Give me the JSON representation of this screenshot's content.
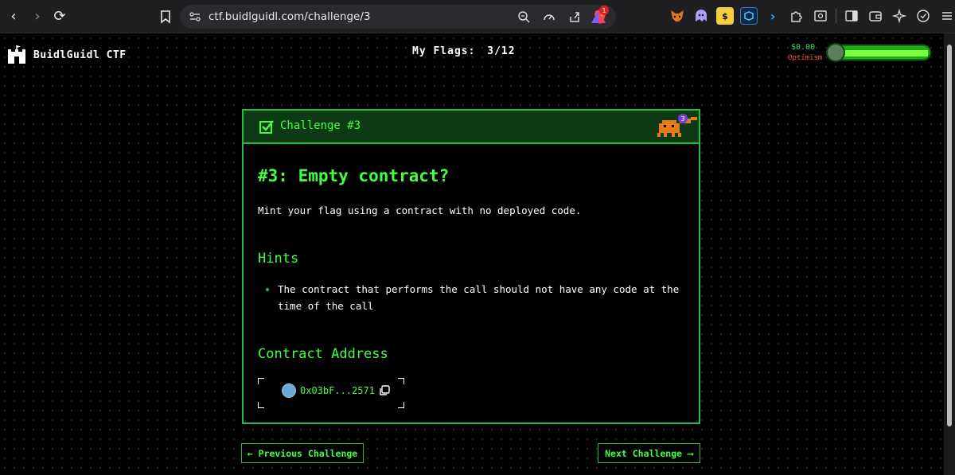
{
  "browser": {
    "url": "ctf.buidlguidl.com/challenge/3",
    "back_glyph": "‹",
    "forward_glyph": "›",
    "reload_glyph": "⟳",
    "badge_count": "1"
  },
  "header": {
    "logo_text": "BuidlGuidl CTF",
    "flags_label": "My Flags:",
    "flags_value": "3/12",
    "wallet_balance": "$0.00",
    "wallet_network": "Optimism"
  },
  "challenge": {
    "header_label": "Challenge #3",
    "badge_number": "3",
    "title": "#3: Empty contract?",
    "description": "Mint your flag using a contract with no deployed code.",
    "hints_heading": "Hints",
    "hints": [
      "The contract that performs the call should not have any code at the time of the call"
    ],
    "contract_heading": "Contract Address",
    "contract_address": "0x03bF...2571"
  },
  "navigation": {
    "previous_label": "← Previous Challenge",
    "next_label": "Next Challenge ⟶"
  },
  "colors": {
    "accent": "#42ff42",
    "border": "#1fbf47",
    "header_bg": "#0b3a14",
    "network": "#ff4b4b"
  }
}
